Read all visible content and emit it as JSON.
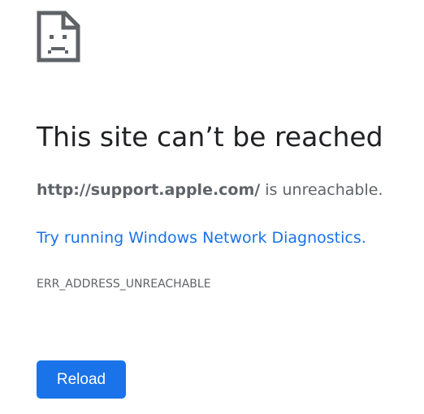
{
  "icon": "sad-page-icon",
  "title": "This site can’t be reached",
  "summary": {
    "host": "http://support.apple.com/",
    "suffix": " is unreachable."
  },
  "diagnostics": {
    "link_text": "Try running Windows Network Diagnostics",
    "period": "."
  },
  "error_code": "ERR_ADDRESS_UNREACHABLE",
  "reload_label": "Reload",
  "colors": {
    "accent": "#1a73e8",
    "title": "#202124",
    "body": "#5f6368"
  }
}
